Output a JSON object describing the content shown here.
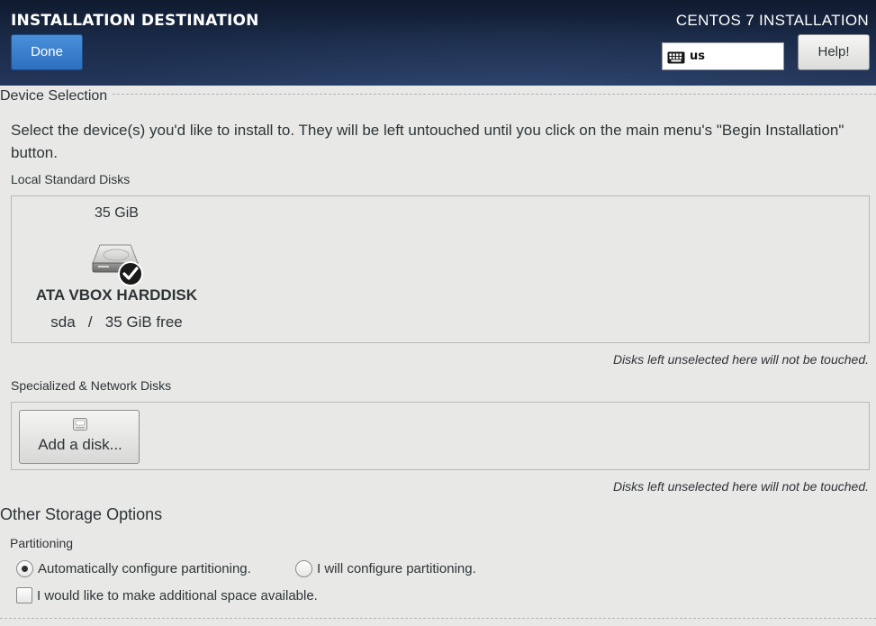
{
  "header": {
    "title": "INSTALLATION DESTINATION",
    "done_label": "Done",
    "product": "CENTOS 7 INSTALLATION",
    "keyboard_layout": "us",
    "help_label": "Help!"
  },
  "device_selection": {
    "title": "Device Selection",
    "description": "Select the device(s) you'd like to install to.  They will be left untouched until you click on the main menu's \"Begin Installation\" button.",
    "local_heading": "Local Standard Disks",
    "disks": [
      {
        "size": "35 GiB",
        "name": "ATA VBOX HARDDISK",
        "detail": "sda   /   35 GiB free",
        "selected": true
      }
    ],
    "local_note": "Disks left unselected here will not be touched.",
    "network_heading": "Specialized & Network Disks",
    "add_disk_label": "Add a disk...",
    "network_note": "Disks left unselected here will not be touched."
  },
  "other_storage": {
    "title": "Other Storage Options",
    "partitioning_heading": "Partitioning",
    "auto_label": "Automatically configure partitioning.",
    "manual_label": "I will configure partitioning.",
    "selected": "auto",
    "additional_space_label": "I would like to make additional space available.",
    "additional_space_checked": false
  },
  "icons": {
    "keyboard": "keyboard-icon",
    "disk": "harddisk-icon",
    "selected_badge": "checkmark-icon",
    "add_disk": "disk-add-icon"
  }
}
